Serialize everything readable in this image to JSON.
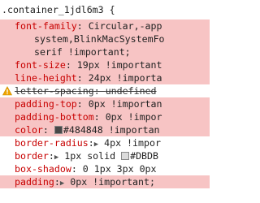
{
  "selector": ".container_1jdl6m3 {",
  "colors": {
    "highlight": "#f7c4c4",
    "property": "#c80000",
    "warning": "#f0a500",
    "color_swatch": "#484848",
    "border_swatch": "#dbdbdb"
  },
  "rules": [
    {
      "prop": "font-family",
      "sep": ": ",
      "value": "Circular,-app",
      "highlighted": true
    },
    {
      "continuation": "system,BlinkMacSystemFo",
      "highlighted": true
    },
    {
      "continuation": "serif !important;",
      "highlighted": true
    },
    {
      "prop": "font-size",
      "sep": ": ",
      "value": "19px !important",
      "highlighted": true
    },
    {
      "prop": "line-height",
      "sep": ": ",
      "value": "24px !importa",
      "highlighted": true
    },
    {
      "prop": "letter-spacing",
      "sep": ": ",
      "value": "undefined",
      "highlighted": false,
      "struck": true,
      "warning_icon": "warning-icon"
    },
    {
      "prop": "padding-top",
      "sep": ": ",
      "value": "0px !importan",
      "highlighted": true
    },
    {
      "prop": "padding-bottom",
      "sep": ": ",
      "value": "0px !impor",
      "highlighted": true
    },
    {
      "prop": "color",
      "sep": ": ",
      "value": "#484848 !importan",
      "highlighted": true,
      "swatch": "#484848"
    },
    {
      "prop": "border-radius",
      "sep": ":",
      "arrow": "▶",
      "value": "4px !impor",
      "highlighted": false
    },
    {
      "prop": "border",
      "sep": ":",
      "arrow": "▶",
      "value": "1px solid ",
      "highlighted": false,
      "swatch": "#dbdbdb",
      "value_after": "#DBDB"
    },
    {
      "prop": "box-shadow",
      "sep": ": ",
      "value": "0 1px 3px 0px",
      "highlighted": false
    },
    {
      "prop": "padding",
      "sep": ":",
      "arrow": "▶",
      "value": "0px !important;",
      "highlighted": true
    }
  ]
}
